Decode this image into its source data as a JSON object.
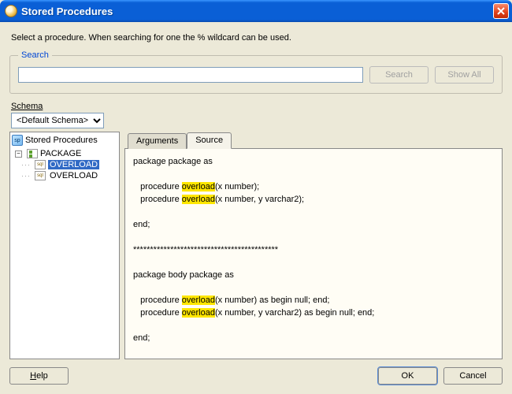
{
  "window": {
    "title": "Stored Procedures"
  },
  "instruction": "Select a procedure. When searching for one the % wildcard can be used.",
  "search": {
    "legend": "Search",
    "value": "",
    "search_btn": "Search",
    "showall_btn": "Show All"
  },
  "schema": {
    "label": "Schema",
    "selected": "<Default Schema>",
    "options": [
      "<Default Schema>"
    ]
  },
  "tree": {
    "root_label": "Stored Procedures",
    "package": {
      "expanded": true,
      "label": "PACKAGE",
      "children": [
        {
          "label": "OVERLOAD",
          "selected": true
        },
        {
          "label": "OVERLOAD",
          "selected": false
        }
      ]
    }
  },
  "tabs": {
    "arguments": "Arguments",
    "source": "Source",
    "active": "source"
  },
  "source": {
    "highlight": "overload",
    "segments": [
      [
        {
          "t": "package package as"
        }
      ],
      [
        {
          "t": ""
        }
      ],
      [
        {
          "t": "   procedure "
        },
        {
          "t": "overload",
          "hl": true
        },
        {
          "t": "(x number);"
        }
      ],
      [
        {
          "t": "   procedure "
        },
        {
          "t": "overload",
          "hl": true
        },
        {
          "t": "(x number, y varchar2);"
        }
      ],
      [
        {
          "t": ""
        }
      ],
      [
        {
          "t": "end;"
        }
      ],
      [
        {
          "t": ""
        }
      ],
      [
        {
          "t": "*******************************************"
        }
      ],
      [
        {
          "t": ""
        }
      ],
      [
        {
          "t": "package body package as"
        }
      ],
      [
        {
          "t": ""
        }
      ],
      [
        {
          "t": "   procedure "
        },
        {
          "t": "overload",
          "hl": true
        },
        {
          "t": "(x number) as begin null; end;"
        }
      ],
      [
        {
          "t": "   procedure "
        },
        {
          "t": "overload",
          "hl": true
        },
        {
          "t": "(x number, y varchar2) as begin null; end;"
        }
      ],
      [
        {
          "t": ""
        }
      ],
      [
        {
          "t": "end;"
        }
      ]
    ]
  },
  "buttons": {
    "help": "Help",
    "ok": "OK",
    "cancel": "Cancel"
  }
}
